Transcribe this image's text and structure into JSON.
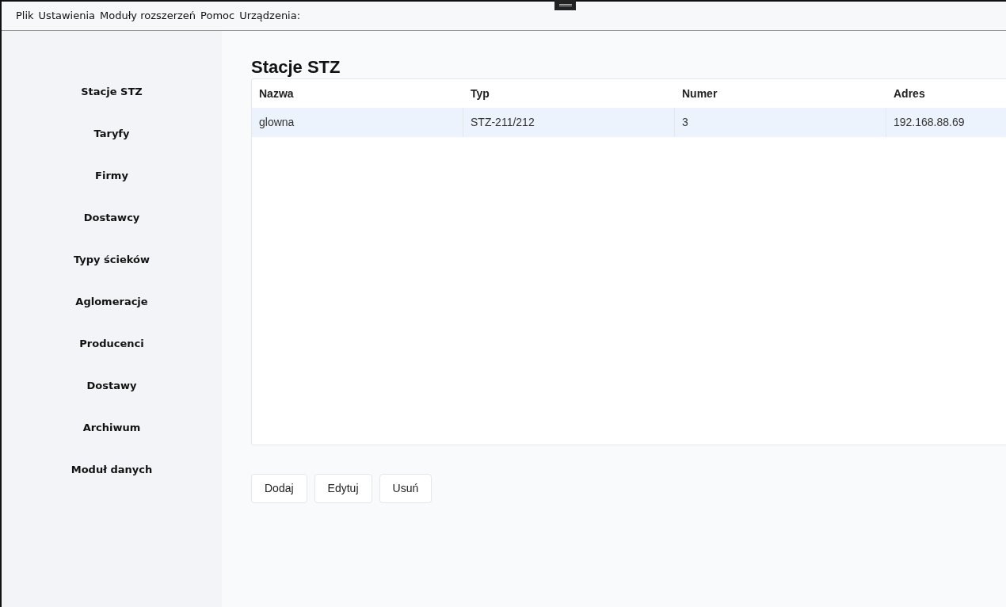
{
  "menu": [
    "Plik",
    "Ustawienia",
    "Moduły rozszerzeń",
    "Pomoc",
    "Urządzenia:"
  ],
  "sidebar": {
    "items": [
      {
        "label": "Stacje STZ"
      },
      {
        "label": "Taryfy"
      },
      {
        "label": "Firmy"
      },
      {
        "label": "Dostawcy"
      },
      {
        "label": "Typy ścieków"
      },
      {
        "label": "Aglomeracje"
      },
      {
        "label": "Producenci"
      },
      {
        "label": "Dostawy"
      },
      {
        "label": "Archiwum"
      },
      {
        "label": "Moduł danych"
      }
    ]
  },
  "page_title": "Stacje STZ",
  "table": {
    "columns": [
      "Nazwa",
      "Typ",
      "Numer",
      "Adres"
    ],
    "rows": [
      {
        "cells": [
          "glowna",
          "STZ-211/212",
          "3",
          "192.168.88.69"
        ],
        "selected": true
      }
    ]
  },
  "buttons": [
    "Dodaj",
    "Edytuj",
    "Usuń"
  ]
}
